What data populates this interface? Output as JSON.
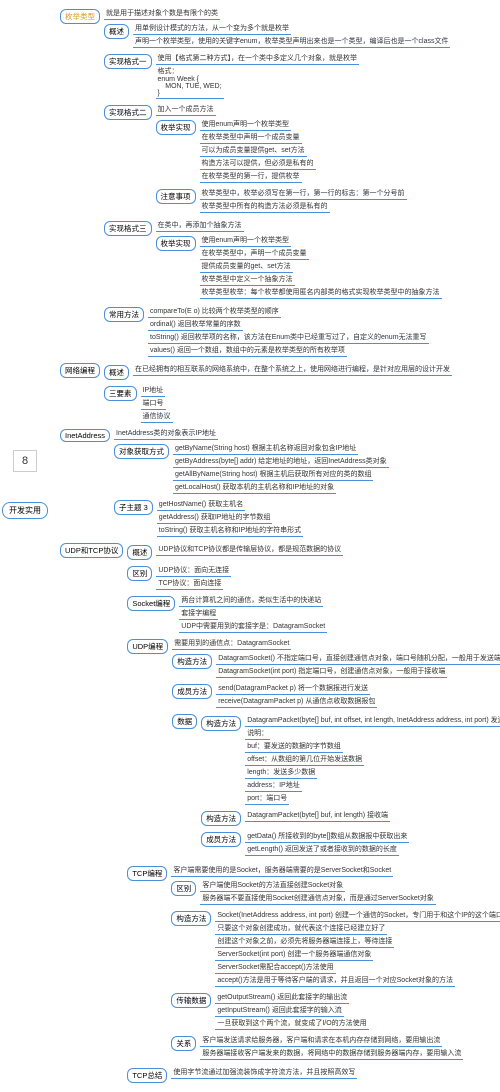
{
  "root_num": "8",
  "root_main": "开发实用",
  "enum": {
    "title": "枚举类型",
    "desc": "就是用于描述对象个数是有限个的类",
    "gaishu": "概述",
    "gs": [
      "用单例设计模式的方法，从一个变为多个就是枚举",
      "声明一个枚举类型，使用的关键字enum，枚举类型声明出来也是一个类型，编译后也是一个class文件"
    ],
    "m1": "实现格式一",
    "m1d": [
      "使用【格式第二种方式】，在一个类中多定义几个对象，就是枚举",
      "格式：\nenum Week {\n    MON, TUE, WED;\n}"
    ],
    "m2": "实现格式二",
    "m2a": "加入一个成员方法",
    "m2b": "枚举实现",
    "m2bl": [
      "使用enum声明一个枚举类型",
      "在枚举类型中声明一个成员变量",
      "可以为成员变量提供get、set方法",
      "构造方法可以提供，但必须是私有的",
      "在枚举类型的第一行，提供枚举"
    ],
    "m2c": "注意事项",
    "m2cl": [
      "枚举类型中，枚举必须写在第一行，第一行的标志：第一个分号前",
      "枚举类型中所有的构造方法必须是私有的"
    ],
    "m3": "实现格式三",
    "m3a": "在类中，再添加个抽象方法",
    "m3b": "枚举实现",
    "m3bl": [
      "使用enum声明一个枚举类型",
      "在枚举类型中，声明一个成员变量",
      "提供成员变量的get、set方法",
      "枚举类型中定义一个抽象方法",
      "枚举类型枚举：每个枚举都使用匿名内部类的格式实现枚举类型中的抽象方法"
    ],
    "cm": "常用方法",
    "cml": [
      "compareTo(E o) 比较两个枚举类型的顺序",
      "ordinal() 返回枚举常量的序数",
      "toString() 返回枚举项的名称，该方法在Enum类中已经重写过了，自定义的enum无法重写",
      "values() 返回一个数组，数组中的元素是枚举类型的所有枚举项"
    ]
  },
  "net": {
    "title": "网络编程",
    "gs": "概述",
    "gsd": "在已经拥有的相互联系的网络系统中，在整个系统之上，使用网络进行编程，是针对应用层的设计开发",
    "sys": "三要素",
    "sysl": [
      "IP地址",
      "端口号",
      "通信协议"
    ]
  },
  "inet": {
    "title": "InetAddress",
    "d": "InetAddress类的对象表示IP地址",
    "gm": "对象获取方式",
    "gml": [
      "getByName(String host) 根据主机名称返回对象包含IP地址",
      "getByAddress(byte[] addr) 给定地址的地址，返回InetAddress类对象",
      "getAllByName(String host) 根据主机后获取所有对应的类的数组",
      "getLocalHost() 获取本机的主机名称和IP地址的对象"
    ],
    "sm": "子主题 3",
    "sml": [
      "getHostName() 获取主机名",
      "getAddress() 获取IP地址的字节数组",
      "toString() 获取主机名称和IP地址的字符串形式"
    ]
  },
  "udp": {
    "title": "UDP和TCP协议",
    "gs": "概述",
    "gsd": "UDP协议和TCP协议都是传输层协议，都是规范数据的协议",
    "qb": "区别",
    "qbl": [
      "UDP协议：面向无连接",
      "TCP协议：面向连接"
    ],
    "sk": "Socket编程",
    "skl": [
      "两台计算机之间的通信，类似生活中的快递站",
      "套接字编程",
      "UDP中需要用到的套接字是：DatagramSocket"
    ],
    "udpe": "UDP编程",
    "udpe_d": "需要用到的通信点：DatagramSocket",
    "udpe_gz": "构造方法",
    "udpe_gzl": [
      "DatagramSocket() 不指定端口号，直接创建通信点对象，端口号随机分配，一般用于发送端",
      "DatagramSocket(int port) 指定端口号，创建通信点对象，一般用于接收端"
    ],
    "udpe_cy": "成员方法",
    "udpe_cyl": [
      "send(DatagramPacket p) 将一个数据报进行发送",
      "receive(DatagramPacket p) 从通信点收取数据报包"
    ],
    "sj": "数据",
    "sj_gz": "构造方法",
    "sj_gzd": "DatagramPacket(byte[] buf, int offset, int length, InetAddress address, int port) 发送端",
    "sj_sjm": [
      "说明：",
      "buf：要发送的数据的字节数组",
      "offset：从数组的第几位开始发送数据",
      "length：发送多少数据",
      "address：IP地址",
      "port：端口号"
    ],
    "sj_gz2": "构造方法",
    "sj_gz2d": "DatagramPacket(byte[] buf, int length) 接收端",
    "sj_cy": "成员方法",
    "sj_cyl": [
      "getData() 所接收到的byte[]数组从数据报中获取出来",
      "getLength() 返回发送了或者接收到的数据的长度"
    ],
    "tcp": "TCP编程",
    "tcp_d": "客户端需要使用的是Socket，服务器端需要的是ServerSocket和Socket",
    "tcp_qb": "区别",
    "tcp_qbl": [
      "客户端使用Socket的方法直接创建Socket对象",
      "服务器端不要直接使用Socket创建通信点对象，而是通过ServerSocket对象"
    ],
    "tcp_gz": "构造方法",
    "tcp_gzl": [
      "Socket(InetAddress address, int port) 创建一个通信的Socket，专门用于和这个IP的这个端口发信息",
      "只要这个对象创建成功，就代表这个连接已经建立好了",
      "创建这个对象之前，必须先将服务器端连接上，等待连接",
      "ServerSocket(int port) 创建一个服务器端通信对象",
      "ServerSocket需配合accept()方法使用",
      "accept()方法是用于等待客户端的请求，并且返回一个对应Socket对象的方法"
    ],
    "tcp_cs": "传输数据",
    "tcp_csl": [
      "getOutputStream() 返回此套接字的输出流",
      "getInputStream() 返回此套接字的输入流",
      "一旦获取到这个两个流，就变成了I/O的方法使用"
    ],
    "tcp_gx": "关系",
    "tcp_gxl": [
      "客户端发送请求给服务器，客户端和请求在本机内存存储到网络，要用输出流",
      "服务器端接收客户端发来的数据，将网络中的数据存储到服务器端内存，要用输入流"
    ],
    "tcp_cl": "TCP总结",
    "tcp_cld": "使用字节流通过加强流装饰成字符流方法，并且按照高效写"
  }
}
